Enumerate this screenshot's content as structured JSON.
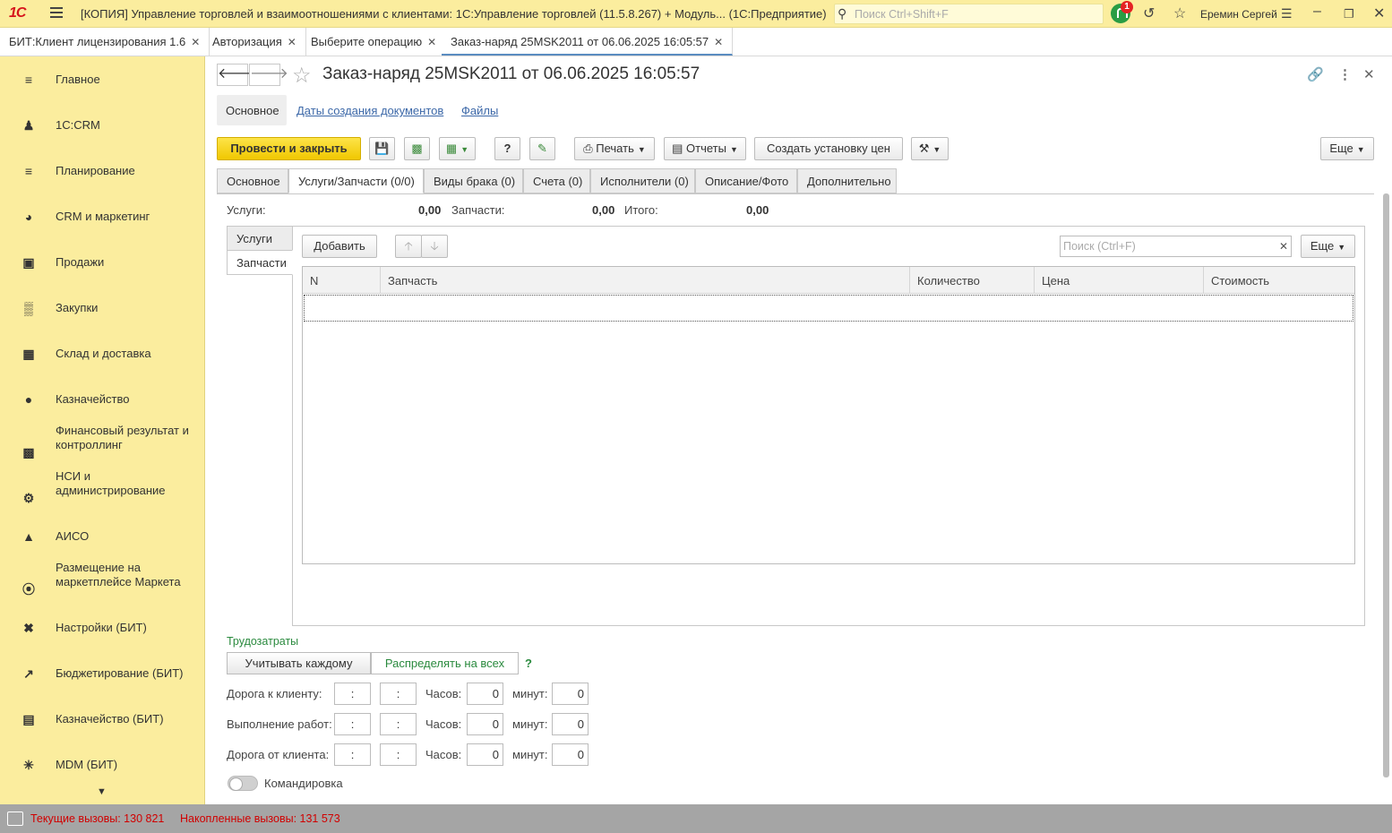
{
  "titlebar": {
    "logo": "1С",
    "title": "[КОПИЯ] Управление торговлей и взаимоотношениями с клиентами: 1С:Управление торговлей (11.5.8.267) + Модуль...  (1С:Предприятие)",
    "search_placeholder": "Поиск Ctrl+Shift+F",
    "notification_count": "1",
    "user": "Еремин Сергей"
  },
  "open_tabs": [
    {
      "label": "БИТ:Клиент лицензирования 1.6"
    },
    {
      "label": "Авторизация"
    },
    {
      "label": "Выберите операцию"
    },
    {
      "label": "Заказ-наряд 25MSK2011 от 06.06.2025 16:05:57"
    }
  ],
  "sidebar": {
    "items": [
      {
        "label": "Главное",
        "icon": "menu-icon"
      },
      {
        "label": "1С:CRM",
        "icon": "users-icon"
      },
      {
        "label": "Планирование",
        "icon": "planning-icon"
      },
      {
        "label": "CRM и маркетинг",
        "icon": "pie-icon"
      },
      {
        "label": "Продажи",
        "icon": "bag-icon"
      },
      {
        "label": "Закупки",
        "icon": "cart-icon"
      },
      {
        "label": "Склад и доставка",
        "icon": "warehouse-icon"
      },
      {
        "label": "Казначейство",
        "icon": "ruble-icon"
      },
      {
        "label": "Финансовый результат и контроллинг",
        "icon": "bar-chart-icon"
      },
      {
        "label": "НСИ и администрирование",
        "icon": "gear-icon"
      },
      {
        "label": "АИСО",
        "icon": "aiso-icon"
      },
      {
        "label": "Размещение на маркетплейсе Маркета",
        "icon": "market-icon"
      },
      {
        "label": "Настройки (БИТ)",
        "icon": "tools-icon"
      },
      {
        "label": "Бюджетирование (БИТ)",
        "icon": "trend-icon"
      },
      {
        "label": "Казначейство (БИТ)",
        "icon": "money-icon"
      },
      {
        "label": "MDM (БИТ)",
        "icon": "mdm-icon"
      }
    ]
  },
  "document": {
    "title": "Заказ-наряд 25MSK2011 от 06.06.2025 16:05:57",
    "subnav": {
      "main": "Основное",
      "dates": "Даты создания документов",
      "files": "Файлы"
    }
  },
  "toolbar": {
    "post_close": "Провести и закрыть",
    "help": "?",
    "print": "Печать",
    "reports": "Отчеты",
    "create_prices": "Создать установку цен",
    "more": "Еще"
  },
  "form_tabs": [
    {
      "label": "Основное"
    },
    {
      "label": "Услуги/Запчасти (0/0)"
    },
    {
      "label": "Виды брака (0)"
    },
    {
      "label": "Счета (0)"
    },
    {
      "label": "Исполнители (0)"
    },
    {
      "label": "Описание/Фото"
    },
    {
      "label": "Дополнительно"
    }
  ],
  "totals": {
    "services_label": "Услуги:",
    "services_value": "0,00",
    "parts_label": "Запчасти:",
    "parts_value": "0,00",
    "total_label": "Итого:",
    "total_value": "0,00"
  },
  "inner_tabs": {
    "services": "Услуги",
    "parts": "Запчасти"
  },
  "parts_table": {
    "add_button": "Добавить",
    "search_placeholder": "Поиск (Ctrl+F)",
    "more": "Еще",
    "columns": [
      "N",
      "Запчасть",
      "Количество",
      "Цена",
      "Стоимость"
    ],
    "rows": []
  },
  "labor": {
    "title": "Трудозатраты",
    "option_each": "Учитывать каждому",
    "option_all": "Распределять на всех",
    "help": "?",
    "hours_label": "Часов:",
    "minutes_label": "минут:",
    "time_placeholder": ":",
    "rows": [
      {
        "label": "Дорога к клиенту:",
        "hours": "0",
        "minutes": "0"
      },
      {
        "label": "Выполнение работ:",
        "hours": "0",
        "minutes": "0"
      },
      {
        "label": "Дорога от клиента:",
        "hours": "0",
        "minutes": "0"
      }
    ],
    "business_trip": "Командировка"
  },
  "statusbar": {
    "current_calls": "Текущие вызовы: 130 821",
    "accumulated_calls": "Накопленные вызовы: 131 573"
  },
  "colors": {
    "accent_yellow": "#fbed9e",
    "primary_button": "#f5d20a",
    "status_red": "#d10000",
    "link_blue": "#3c68a8",
    "green_text": "#2a8a3e"
  }
}
